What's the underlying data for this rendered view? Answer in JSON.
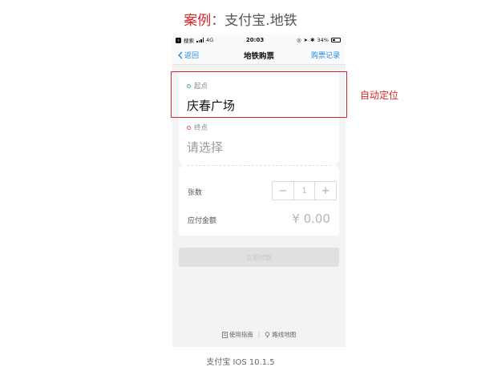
{
  "header": {
    "case_label": "案例",
    "title_rest": "：支付宝.地铁"
  },
  "statusbar": {
    "carrier": "搜索",
    "network": "4G",
    "time": "20:03",
    "battery": "34%"
  },
  "navbar": {
    "back_label": "返回",
    "title": "地铁购票",
    "right_label": "购票记录"
  },
  "ticket": {
    "start_label": "起点",
    "start_value": "庆春广场",
    "end_label": "终点",
    "end_placeholder": "请选择"
  },
  "order": {
    "qty_label": "张数",
    "qty_value": "1",
    "minus": "−",
    "plus": "+",
    "amount_label": "应付金额",
    "amount_value": "¥ 0.00"
  },
  "pay_button": "立即付款",
  "footer": {
    "guide": "使用指南",
    "map": "路线地图"
  },
  "annotation": "自动定位",
  "caption": "支付宝 IOS 10.1.5",
  "colors": {
    "accent_blue": "#1e88e5",
    "annotation_red": "#d8262a"
  }
}
